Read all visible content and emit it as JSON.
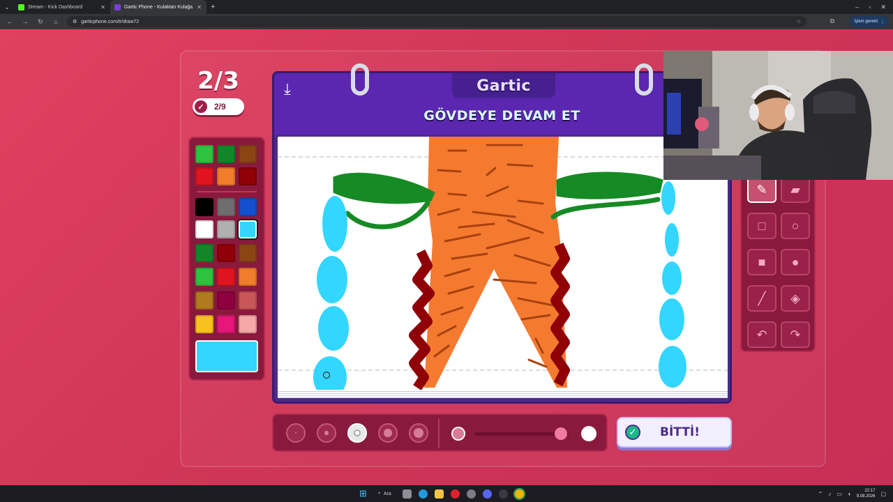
{
  "browser": {
    "tabs": [
      {
        "title": "Stream - Kick Dashboard",
        "favicon_color": "#53fc18"
      },
      {
        "title": "Gartic Phone - Kulaktan Kulağa",
        "favicon_color": "#7b3fd6"
      }
    ],
    "url": "garticphone.com/tr/draw72",
    "profile_label": "İşlem gerekli"
  },
  "game": {
    "round": "2/3",
    "progress": "2/9",
    "logo": "Gartic",
    "task": "GÖVDEYE DEVAM ET",
    "done_label": "BİTTİ!",
    "palette": [
      "#2ec23e",
      "#14862a",
      "#8b4513",
      "#e0141e",
      "#f07d2c",
      "#8f0007",
      "#000000",
      "#6e6e6e",
      "#1250cf",
      "#ffffff",
      "#b0b0b0",
      "#33d6ff",
      "#14862a",
      "#8f0007",
      "#8b4513",
      "#2ec23e",
      "#e0141e",
      "#f07d2c",
      "#b07a1e",
      "#8f0040",
      "#c95757",
      "#f7c21c",
      "#e6167a",
      "#f4a8a8"
    ],
    "selected_color": "#33d6ff",
    "brush_sizes": [
      "xs",
      "s",
      "m",
      "l",
      "xl"
    ],
    "selected_brush_size": "m",
    "tools": [
      "pen-icon",
      "eraser-icon",
      "rect-outline-icon",
      "circle-outline-icon",
      "rect-filled-icon",
      "circle-filled-icon",
      "line-icon",
      "fill-bucket-icon",
      "undo-icon",
      "redo-icon"
    ],
    "selected_tool": "pen-icon",
    "opacity": 0.92
  },
  "taskbar": {
    "search_label": "Ara",
    "time": "22:17",
    "date": "9.08.2026"
  }
}
